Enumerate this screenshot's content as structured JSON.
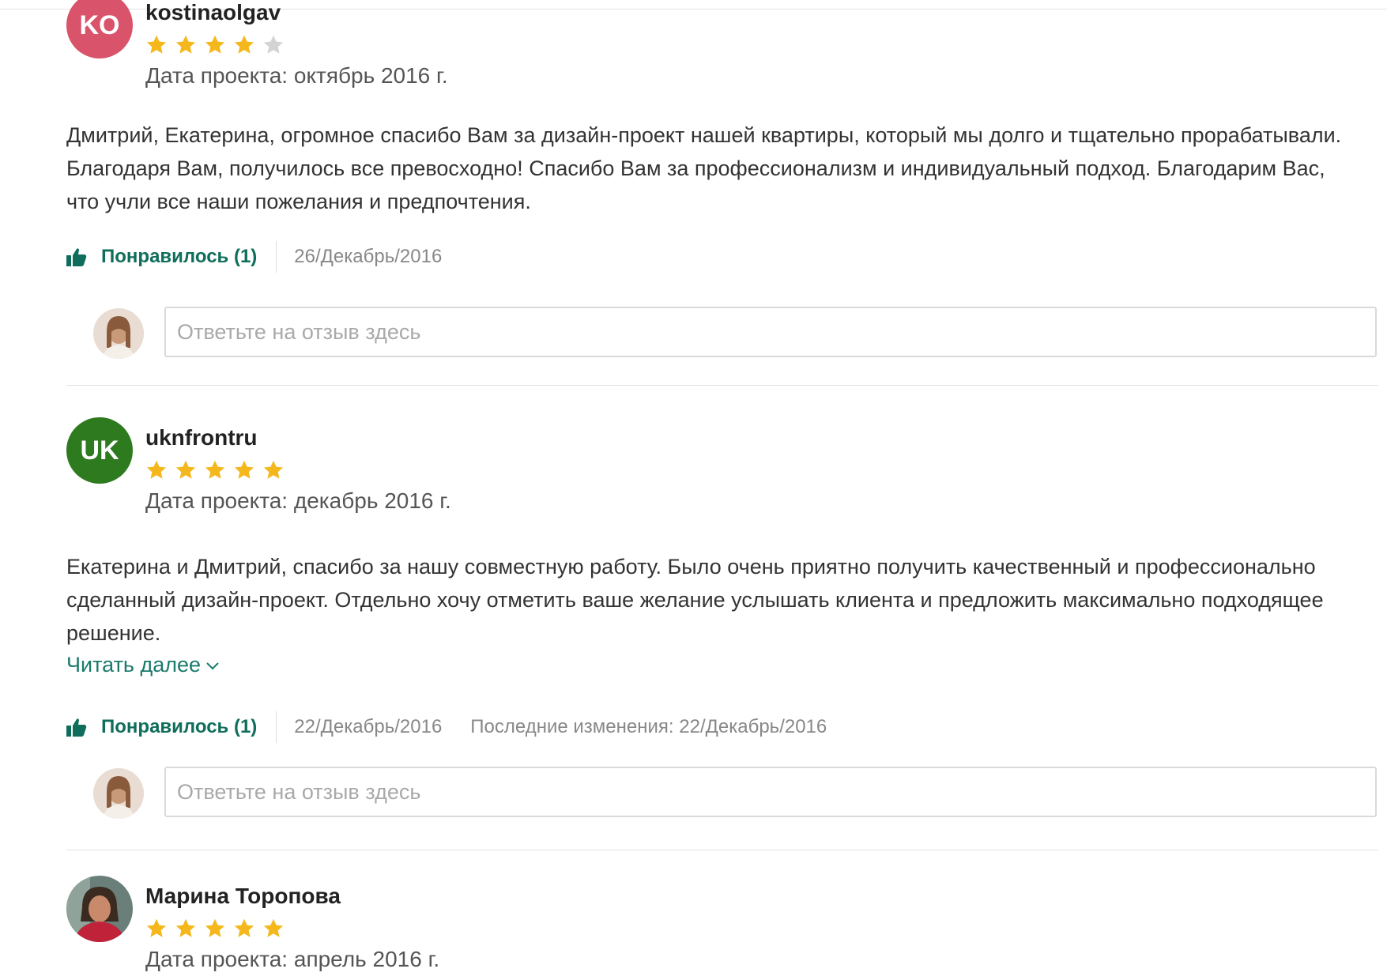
{
  "colors": {
    "star_filled": "#f5b81c",
    "star_empty": "#d3d3d3",
    "accent": "#0f6e5b",
    "link": "#1a7a6c"
  },
  "reviews": [
    {
      "avatar_initials": "KO",
      "avatar_color": "#d9536b",
      "username": "kostinaolgav",
      "rating": 4,
      "max_rating": 5,
      "project_date": "Дата проекта: октябрь 2016 г.",
      "text": "Дмитрий, Екатерина, огромное спасибо Вам за дизайн-проект нашей квартиры, который мы долго и тщательно прорабатывали. Благодаря Вам, получилось все превосходно! Спасибо Вам за профессионализм и индивидуальный подход. Благодарим Вас, что учли все наши пожелания и предпочтения.",
      "like_label": "Понравилось (1)",
      "date": "26/Декабрь/2016",
      "reply_placeholder": "Ответьте на отзыв здесь"
    },
    {
      "avatar_initials": "UK",
      "avatar_color": "#2d7a1f",
      "username": "uknfrontru",
      "rating": 5,
      "max_rating": 5,
      "project_date": "Дата проекта: декабрь 2016 г.",
      "text": "Екатерина и Дмитрий, спасибо за нашу совместную работу. Было очень приятно получить качественный и профессионально сделанный дизайн-проект. Отдельно хочу отметить ваше желание услышать клиента и предложить максимально подходящее решение.",
      "read_more": "Читать далее",
      "like_label": "Понравилось (1)",
      "date": "22/Декабрь/2016",
      "modified": "Последние изменения:  22/Декабрь/2016",
      "reply_placeholder": "Ответьте на отзыв здесь"
    },
    {
      "avatar_type": "photo",
      "username": "Марина Торопова",
      "rating": 5,
      "max_rating": 5,
      "project_date": "Дата проекта: апрель 2016 г."
    }
  ]
}
